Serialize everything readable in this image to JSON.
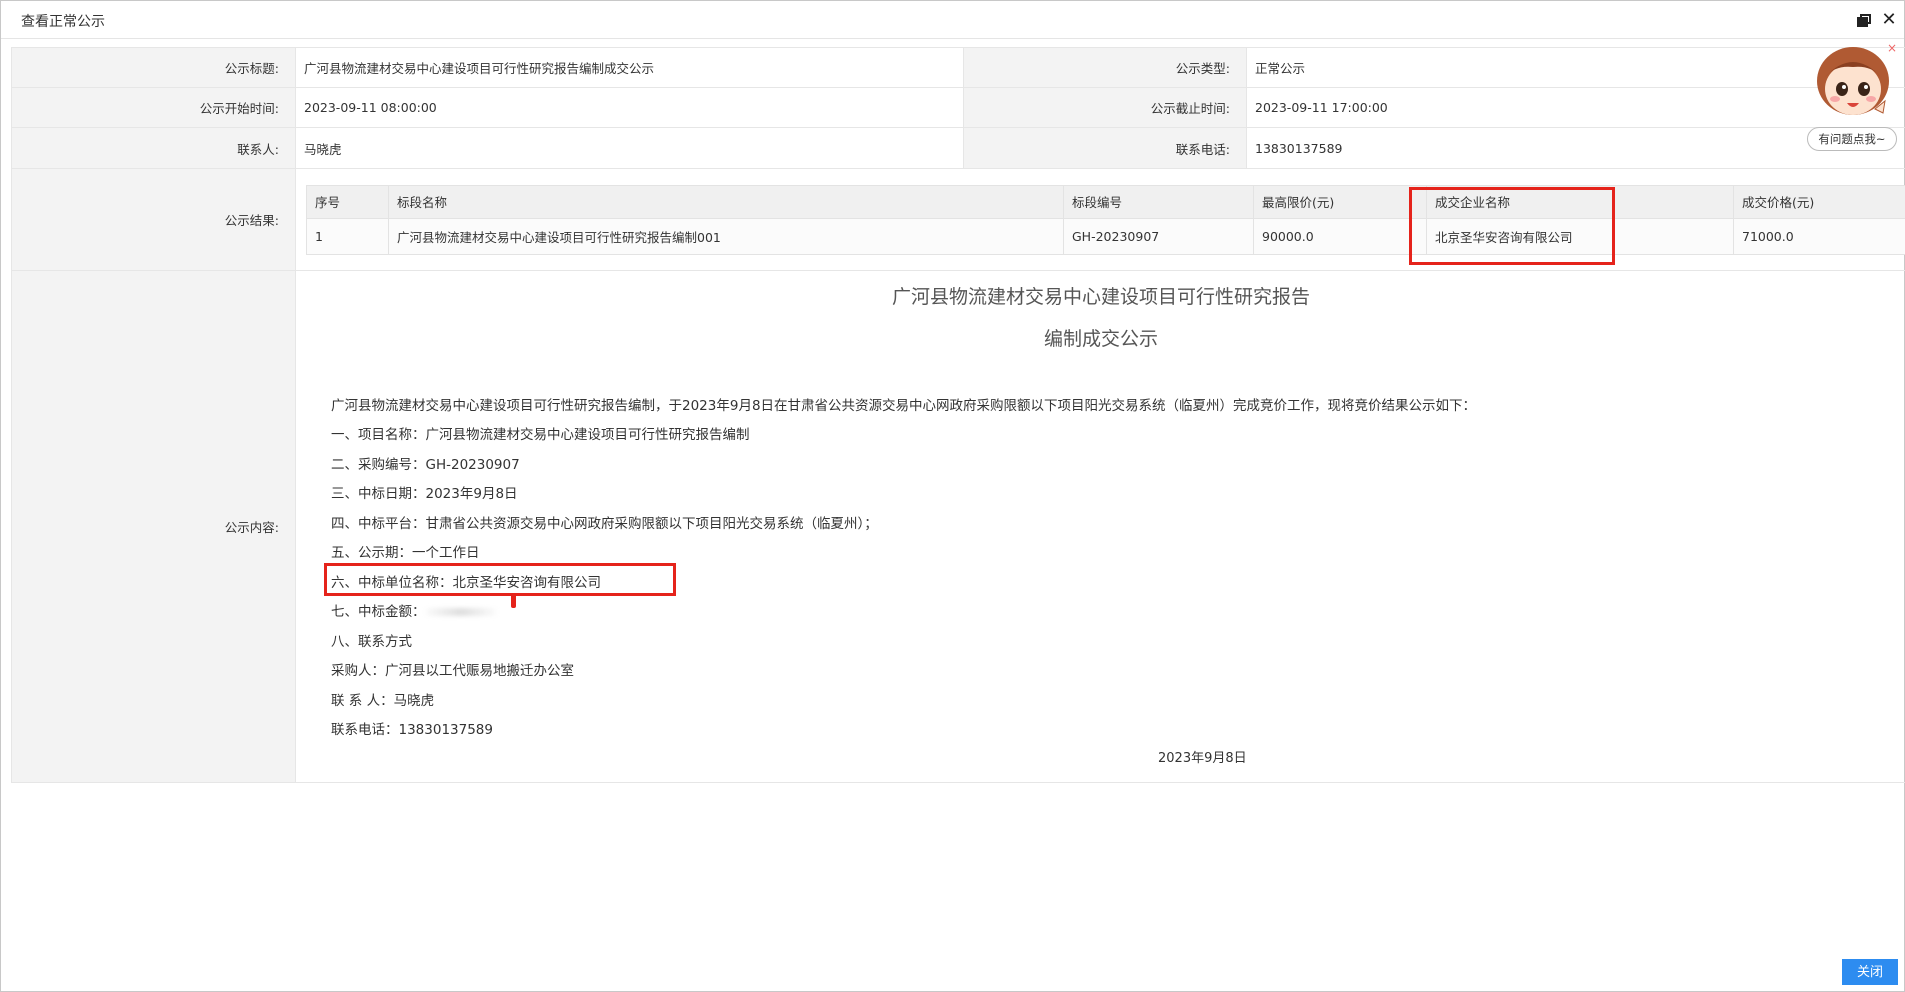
{
  "window": {
    "title": "查看正常公示",
    "close_label": "关闭"
  },
  "fields": {
    "title_label": "公示标题:",
    "title_value": "广河县物流建材交易中心建设项目可行性研究报告编制成交公示",
    "type_label": "公示类型:",
    "type_value": "正常公示",
    "start_label": "公示开始时间:",
    "start_value": "2023-09-11 08:00:00",
    "end_label": "公示截止时间:",
    "end_value": "2023-09-11 17:00:00",
    "contact_label": "联系人:",
    "contact_value": "马晓虎",
    "phone_label": "联系电话:",
    "phone_value": "13830137589",
    "result_label": "公示结果:",
    "content_label": "公示内容:"
  },
  "result_table": {
    "headers": [
      "序号",
      "标段名称",
      "标段编号",
      "最高限价(元)",
      "成交企业名称",
      "成交价格(元)"
    ],
    "rows": [
      [
        "1",
        "广河县物流建材交易中心建设项目可行性研究报告编制001",
        "GH-20230907",
        "90000.0",
        "北京圣华安咨询有限公司",
        "71000.0"
      ]
    ]
  },
  "content": {
    "title_line1": "广河县物流建材交易中心建设项目可行性研究报告",
    "title_line2": "编制成交公示",
    "lines": [
      "广河县物流建材交易中心建设项目可行性研究报告编制，于2023年9月8日在甘肃省公共资源交易中心网政府采购限额以下项目阳光交易系统（临夏州）完成竞价工作，现将竞价结果公示如下：",
      "一、项目名称：广河县物流建材交易中心建设项目可行性研究报告编制",
      "二、采购编号：GH-20230907",
      "三、中标日期：2023年9月8日",
      "四、中标平台：甘肃省公共资源交易中心网政府采购限额以下项目阳光交易系统（临夏州）；",
      "五、公示期：一个工作日",
      "六、中标单位名称：北京圣华安咨询有限公司",
      "七、中标金额：",
      "八、联系方式",
      "采购人：广河县以工代赈易地搬迁办公室",
      "联  系  人：马晓虎",
      "联系电话：13830137589"
    ],
    "date": "2023年9月8日"
  },
  "helper": {
    "bubble_text": "有问题点我~",
    "close_glyph": "×"
  },
  "colors": {
    "highlight": "#e5231b",
    "primary_button": "#2d8cf0",
    "label_bg": "#f3f3f3"
  }
}
